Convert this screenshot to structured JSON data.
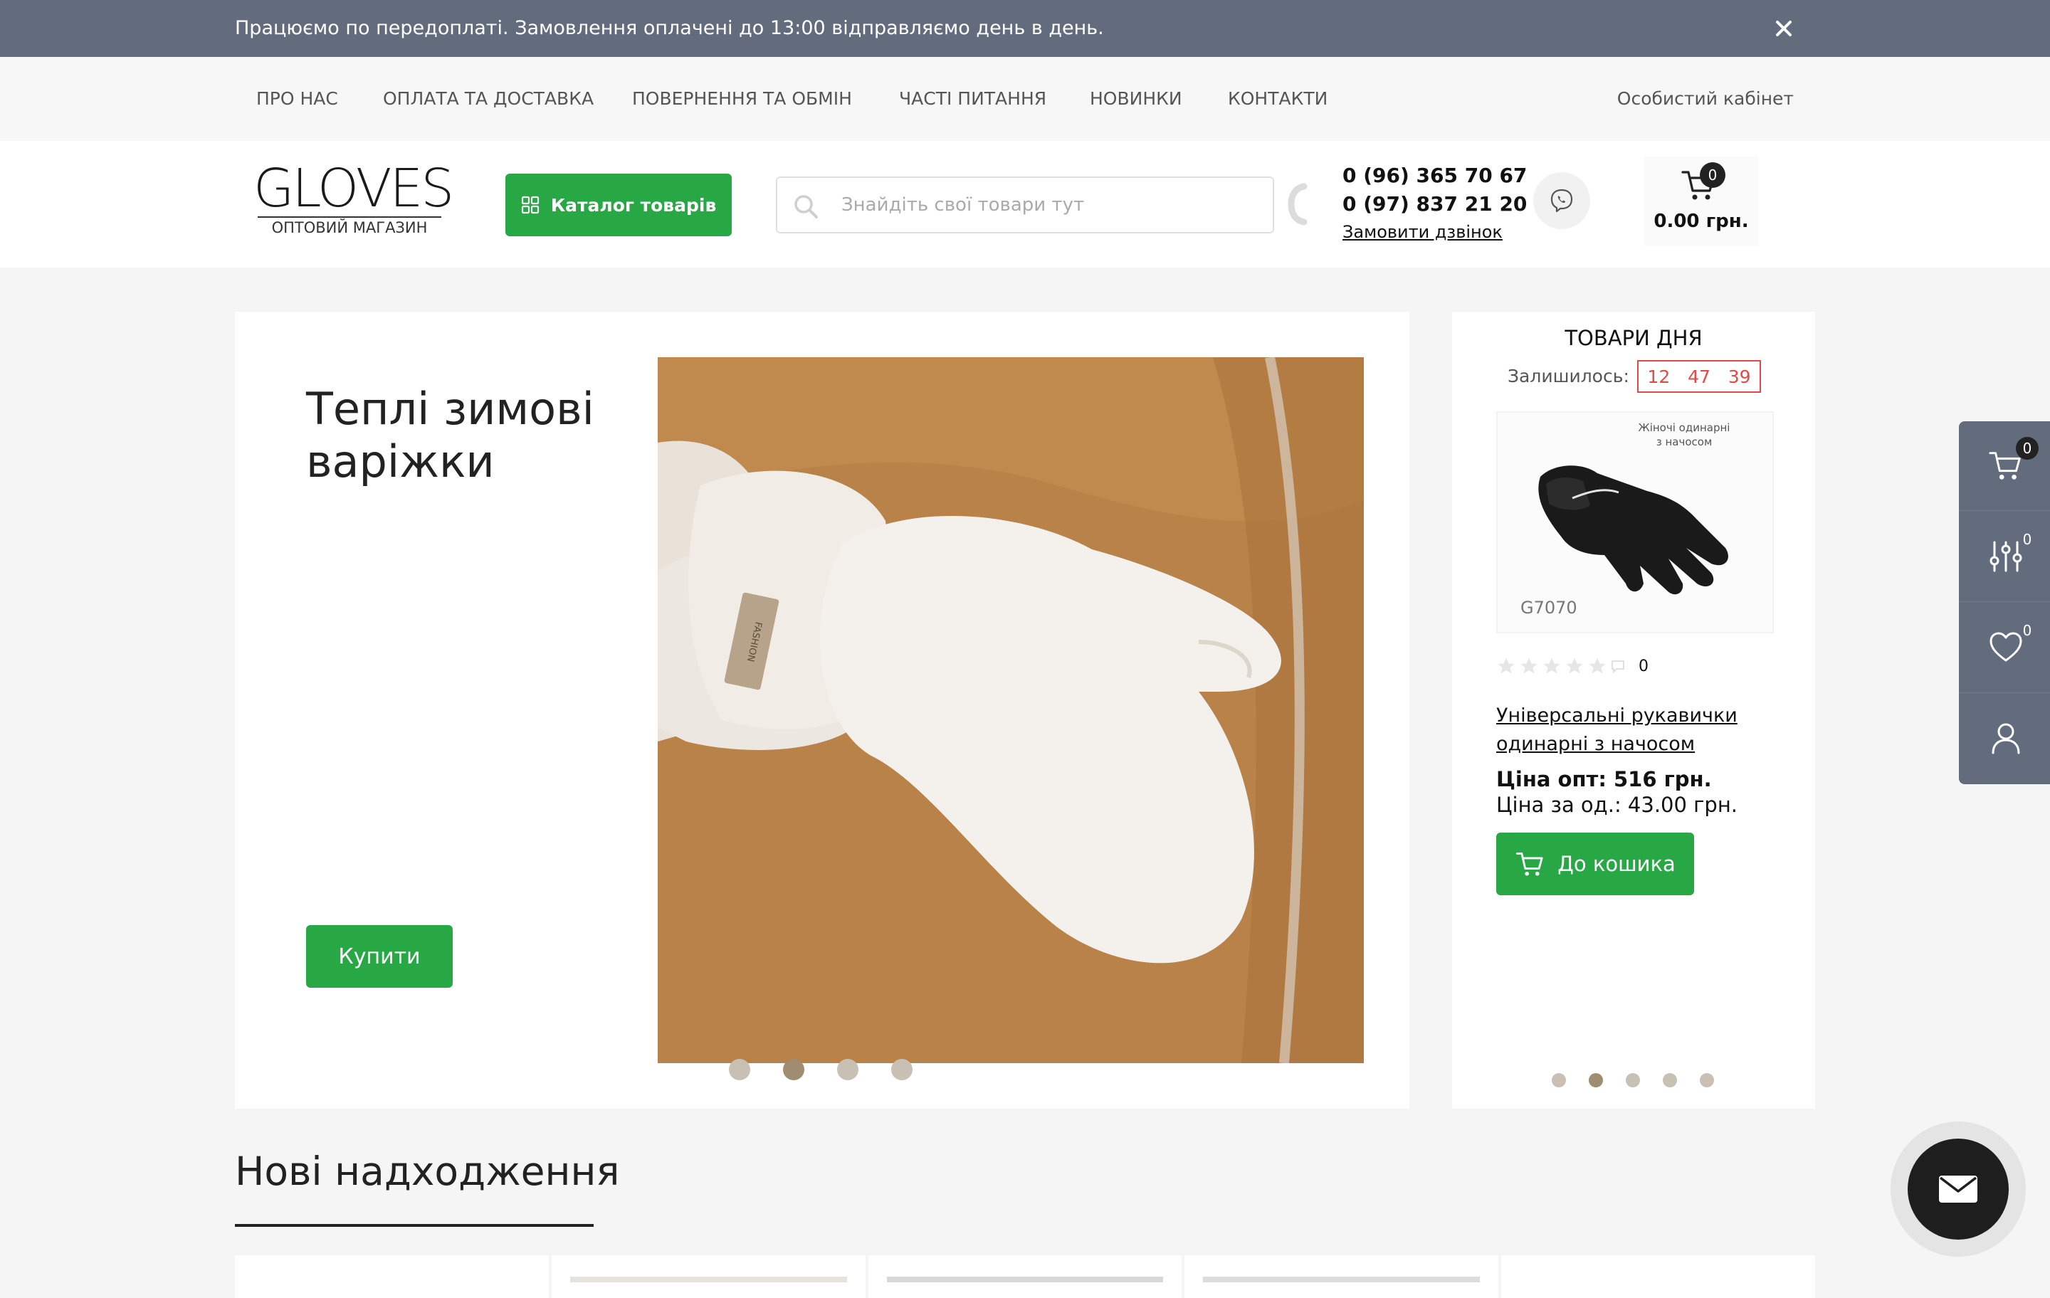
{
  "notice": {
    "text": "Працюємо по передоплаті. Замовлення оплачені до 13:00 відправляємо день в день."
  },
  "nav": {
    "items": [
      {
        "label": "ПРО НАС"
      },
      {
        "label": "ОПЛАТА ТА ДОСТАВКА"
      },
      {
        "label": "ПОВЕРНЕННЯ ТА ОБМІН"
      },
      {
        "label": "ЧАСТІ ПИТАННЯ"
      },
      {
        "label": "НОВИНКИ"
      },
      {
        "label": "КОНТАКТИ"
      }
    ],
    "account": "Особистий кабінет"
  },
  "header": {
    "logo_main": "GLOVES",
    "logo_sub": "ОПТОВИЙ МАГАЗИН",
    "catalog_label": "Каталог товарів",
    "search_placeholder": "Знайдіть свої товари тут",
    "phone1": "0 (96) 365 70 67",
    "phone2": "0 (97) 837 21 20",
    "callback": "Замовити дзвінок",
    "cart_count": "0",
    "cart_total": "0.00 грн."
  },
  "hero": {
    "title": "Теплі зимові варіжки",
    "buy_label": "Купити",
    "image_label": "FASHION",
    "slides_count": 4,
    "active_slide": 2
  },
  "deals": {
    "title": "ТОВАРИ ДНЯ",
    "remaining_label": "Залишилось:",
    "timer": {
      "hours": "12",
      "minutes": "47",
      "seconds": "39"
    },
    "image_caption_line1": "Жіночі одинарні",
    "image_caption_line2": "з начосом",
    "image_code": "G7070",
    "rating_count": "0",
    "product_name": "Універсальні рукавички одинарні з начосом",
    "price_opt": "Ціна опт: 516 грн.",
    "price_unit": "Ціна за од.: 43.00 грн.",
    "to_cart_label": "До кошика",
    "slides_count": 5,
    "active_slide": 2
  },
  "section": {
    "title": "Нові надходження"
  },
  "side_panel": {
    "cart_count": "0",
    "compare_count": "0",
    "wishlist_count": "0"
  },
  "colors": {
    "notice_bg": "#636c7c",
    "accent_green": "#27a844",
    "timer_red": "#e04a4a"
  }
}
